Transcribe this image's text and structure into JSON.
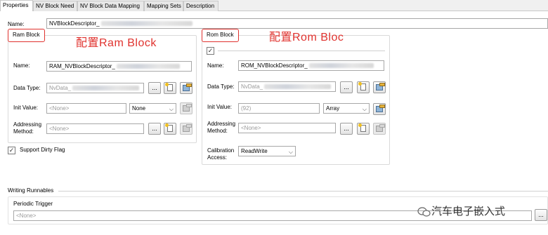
{
  "tabs": [
    "Properties",
    "NV Block Need",
    "NV Block Data Mapping",
    "Mapping Sets",
    "Description"
  ],
  "name_label": "Name:",
  "name_value": "NVBlockDescriptor_",
  "ram": {
    "title": "Ram Block",
    "annotation": "配置Ram  Block",
    "name_label": "Name:",
    "name_value": "RAM_NVBlockDescriptor_",
    "data_type_label": "Data Type:",
    "data_type_value": "NvData_",
    "init_label": "Init Value:",
    "init_value": "<None>",
    "init_select": "None",
    "addressing_label_1": "Addressing",
    "addressing_label_2": "Method:",
    "addressing_value": "<None>",
    "browse": "..."
  },
  "support_dirty_flag": "Support Dirty Flag",
  "rom": {
    "title": "Rom Block",
    "annotation": "配置Rom  Bloc",
    "name_label": "Name:",
    "name_value": "ROM_NVBlockDescriptor_",
    "data_type_label": "Data Type:",
    "data_type_value": "NvData_",
    "init_label": "Init Value:",
    "init_value": "(92)",
    "init_select": "Array",
    "addressing_label_1": "Addressing",
    "addressing_label_2": "Method:",
    "addressing_value": "<None>",
    "calibration_label_1": "Calibration",
    "calibration_label_2": "Access:",
    "calibration_value": "ReadWrite",
    "browse": "..."
  },
  "writing_runnables": "Writing Runnables",
  "periodic_trigger": "Periodic Trigger",
  "periodic_value": "<None>",
  "browse": "...",
  "watermark": "汽车电子嵌入式"
}
